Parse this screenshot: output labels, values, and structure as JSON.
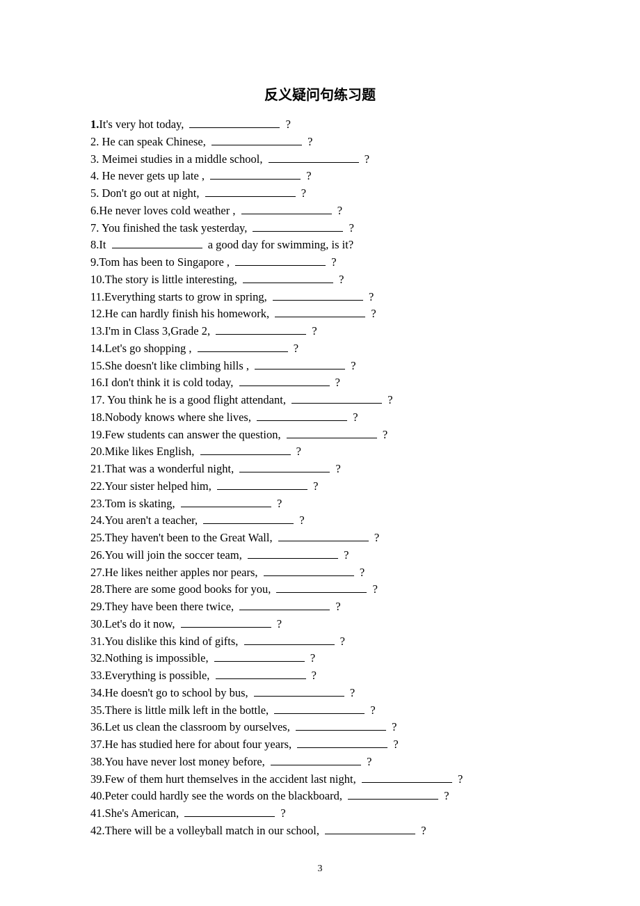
{
  "title": "反义疑问句练习题",
  "items": [
    {
      "pre": "It's very hot today,  ",
      "post": " ?"
    },
    {
      "pre": " He can speak Chinese,   ",
      "post": " ?"
    },
    {
      "pre": " Meimei studies in a middle school, ",
      "post": " ?"
    },
    {
      "pre": " He never gets up late ,  ",
      "post": " ?"
    },
    {
      "pre": " Don't go out at night, ",
      "post": " ?"
    },
    {
      "pre": "He never loves cold weather ,   ",
      "post": " ?"
    },
    {
      "pre": " You finished the task yesterday,   ",
      "post": " ?"
    },
    {
      "pre": "It  ",
      "post": "  a  good day for swimming, is it?"
    },
    {
      "pre": "Tom has been to Singapore ,  ",
      "post": " ?"
    },
    {
      "pre": "The story is little interesting, ",
      "post": " ?"
    },
    {
      "pre": "Everything starts to grow in spring, ",
      "post": " ?"
    },
    {
      "pre": "He can hardly finish his homework, ",
      "post": " ?"
    },
    {
      "pre": "I'm in Class 3,Grade 2,  ",
      "post": " ?"
    },
    {
      "pre": "Let's go shopping ,  ",
      "post": " ?"
    },
    {
      "pre": "She doesn't like climbing hills ,  ",
      "post": " ?"
    },
    {
      "pre": "I don't think it is cold today,  ",
      "post": " ?"
    },
    {
      "pre": " You think he is a good flight attendant,  ",
      "post": " ?"
    },
    {
      "pre": "Nobody knows where she lives,  ",
      "post": " ?"
    },
    {
      "pre": "Few students can answer the question, ",
      "post": " ?"
    },
    {
      "pre": "Mike likes English,  ",
      "post": " ?"
    },
    {
      "pre": "That was a wonderful night, ",
      "post": " ?"
    },
    {
      "pre": "Your sister helped him, ",
      "post": " ?"
    },
    {
      "pre": "Tom is skating, ",
      "post": " ?"
    },
    {
      "pre": "You aren't a teacher,  ",
      "post": " ?"
    },
    {
      "pre": "They haven't been to the Great Wall, ",
      "post": " ?"
    },
    {
      "pre": "You will join the soccer team,  ",
      "post": " ?"
    },
    {
      "pre": "He likes neither apples nor pears, ",
      "post": " ?"
    },
    {
      "pre": "There are some good books for you,  ",
      "post": " ?"
    },
    {
      "pre": "They have been there twice,  ",
      "post": " ?"
    },
    {
      "pre": "Let's do it now,   ",
      "post": " ?"
    },
    {
      "pre": "You dislike this kind of gifts,  ",
      "post": " ?"
    },
    {
      "pre": "Nothing is impossible,  ",
      "post": " ?"
    },
    {
      "pre": "Everything is possible,  ",
      "post": " ?"
    },
    {
      "pre": "He doesn't go to school by bus,  ",
      "post": " ?"
    },
    {
      "pre": "There is little milk left in the bottle,  ",
      "post": " ?"
    },
    {
      "pre": "Let us clean the classroom by ourselves,  ",
      "post": " ?"
    },
    {
      "pre": "He has studied here for about four years,  ",
      "post": " ?"
    },
    {
      "pre": "You have never lost money before,  ",
      "post": " ?"
    },
    {
      "pre": "Few of them hurt themselves in the accident last night, ",
      "post": " ?"
    },
    {
      "pre": "Peter could hardly see the words on the blackboard,  ",
      "post": " ?"
    },
    {
      "pre": "She's American,   ",
      "post": " ?"
    },
    {
      "pre": "There will be a volleyball match in our school, ",
      "post": " ?"
    }
  ],
  "page_number": "3"
}
